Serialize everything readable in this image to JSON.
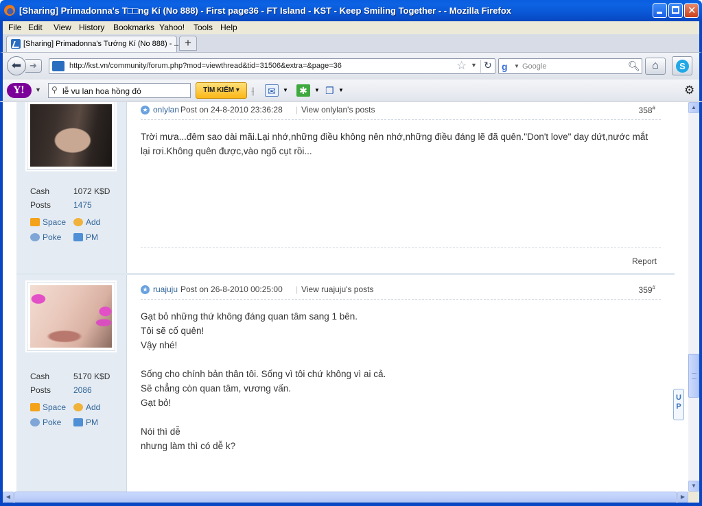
{
  "window": {
    "title": "[Sharing] Primadonna's T□□ng Kí (No 888) - First page36 - FT Island - KST - Keep Smiling Together - - Mozilla Firefox"
  },
  "menu": [
    "File",
    "Edit",
    "View",
    "History",
    "Bookmarks",
    "Yahoo!",
    "Tools",
    "Help"
  ],
  "tabs": [
    {
      "label": "[Sharing] Primadonna's Tướng Kí (No 888) - ..."
    }
  ],
  "nav": {
    "url": "http://kst.vn/community/forum.php?mod=viewthread&tid=31506&extra=&page=36",
    "search_placeholder": "Google"
  },
  "yahoo": {
    "search_value": "lễ vu lan hoa hồng đỏ",
    "search_button": "TÌM KIẾM"
  },
  "posts": [
    {
      "author": "onlylan",
      "posted": "Post on 24-8-2010 23:36:28",
      "view_posts": "View onlylan's posts",
      "number": "358",
      "number_suffix": "#",
      "cash_label": "Cash",
      "cash_value": "1072 K$D",
      "posts_label": "Posts",
      "posts_value": "1475",
      "links": {
        "space": "Space",
        "add": "Add",
        "poke": "Poke",
        "pm": "PM"
      },
      "message": "Trời mưa...đêm sao dài mãi.Lại nhớ,những điều không nên nhớ,những điều đáng lẽ đã quên.\"Don't love\" day dứt,nước mắt\nlại rơi.Không quên được,vào ngõ cụt rồi...",
      "report": "Report"
    },
    {
      "author": "ruajuju",
      "posted": "Post on 26-8-2010 00:25:00",
      "view_posts": "View ruajuju's posts",
      "number": "359",
      "number_suffix": "#",
      "cash_label": "Cash",
      "cash_value": "5170 K$D",
      "posts_label": "Posts",
      "posts_value": "2086",
      "links": {
        "space": "Space",
        "add": "Add",
        "poke": "Poke",
        "pm": "PM"
      },
      "message": "Gạt bỏ những thứ không đáng quan tâm sang 1 bên.\nTôi sẽ cố quên!\nVậy nhé!\n\nSống cho chính bản thân tôi. Sống vì tôi chứ không vì ai cả.\nSẽ chẳng còn quan tâm, vương vấn.\nGạt bỏ!\n\nNói thì dễ\nnhưng làm thì có dễ k?"
    }
  ],
  "up_button": "UP",
  "colors": {
    "link": "#336699",
    "sidebar_bg": "#e4ebf3",
    "titlebar": "#0a5ddf"
  }
}
